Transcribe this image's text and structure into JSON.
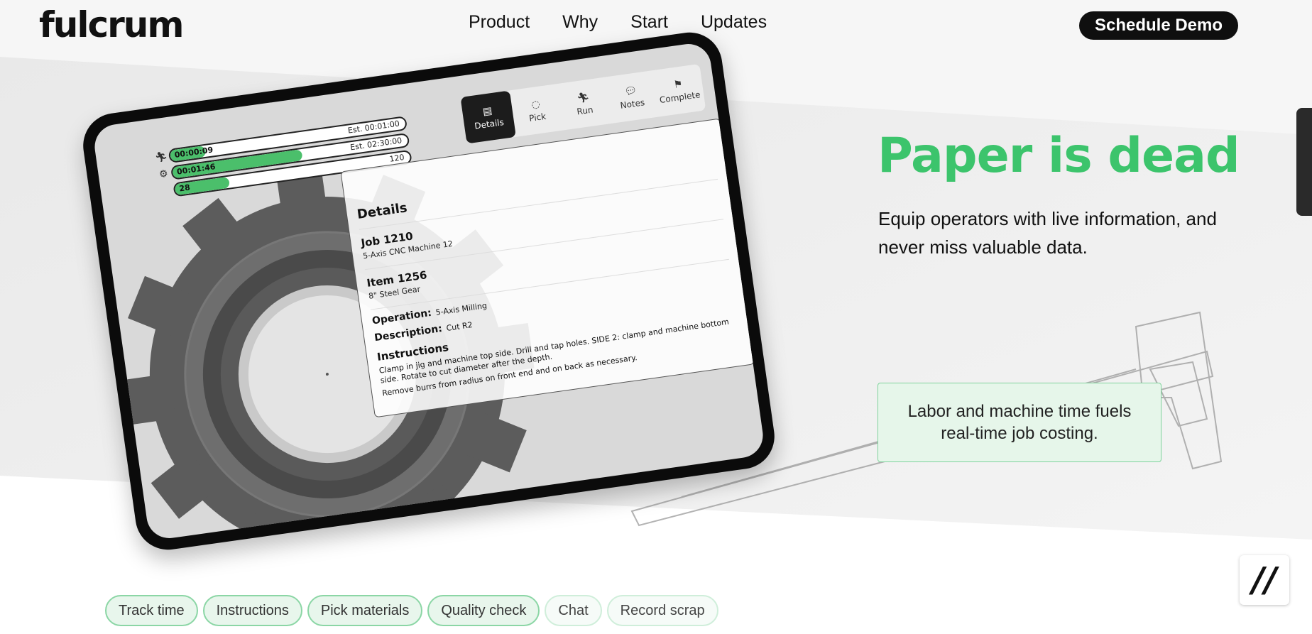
{
  "logo": "fulcrum",
  "nav": [
    "Product",
    "Why",
    "Start",
    "Updates"
  ],
  "cta_label": "Schedule Demo",
  "hero": {
    "title": "Paper is dead",
    "subtitle": "Equip operators with live information, and never miss valuable data.",
    "callout": "Labor and machine time fuels real-time job costing."
  },
  "tablet": {
    "bars": [
      {
        "icon": "runner-icon",
        "value": "00:00:09",
        "est": "Est. 00:01:00",
        "progress": 0.15
      },
      {
        "icon": "gears-icon",
        "value": "00:01:46",
        "est": "Est. 02:30:00",
        "progress": 0.55
      },
      {
        "icon": "",
        "value": "28",
        "est": "120",
        "progress": 0.23
      }
    ],
    "tabs": [
      "Details",
      "Pick",
      "Run",
      "Notes",
      "Complete"
    ],
    "details_title": "Details",
    "job": {
      "title": "Job 1210",
      "sub": "5-Axis CNC Machine 12"
    },
    "item": {
      "title": "Item 1256",
      "sub": "8\" Steel Gear"
    },
    "operation_label": "Operation:",
    "operation_value": "5-Axis Milling",
    "description_label": "Description:",
    "description_value": "Cut R2",
    "instructions_title": "Instructions",
    "instructions_1": "Clamp in jig and machine top side. Drill and tap holes. SIDE 2: clamp and machine bottom side. Rotate to cut diameter after the depth.",
    "instructions_2": "Remove burrs from radius on front end and on back as necessary."
  },
  "chips": [
    "Track time",
    "Instructions",
    "Pick materials",
    "Quality check",
    "Chat",
    "Record scrap"
  ],
  "accent_color": "#3cc46c"
}
